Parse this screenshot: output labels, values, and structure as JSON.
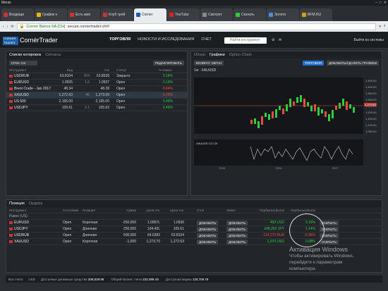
{
  "window": {
    "menu": "Меню"
  },
  "tabs": [
    {
      "label": "Входящи",
      "color": "#cc3333"
    },
    {
      "label": "График н",
      "color": "#e6b800"
    },
    {
      "label": "Есть жив",
      "color": "#cc3333"
    },
    {
      "label": "Клуб трей",
      "color": "#cc3333"
    },
    {
      "label": "Corner",
      "color": "#1f5fa8"
    },
    {
      "label": "YouTube",
      "color": "#e62117"
    },
    {
      "label": "Смотрет",
      "color": "#888888"
    },
    {
      "label": "Скачать",
      "color": "#2ecc40"
    },
    {
      "label": "Золото",
      "color": "#4a90d9"
    },
    {
      "label": "BFM.RU",
      "color": "#d4a017"
    }
  ],
  "address": {
    "site": "Corner Banca SA [CH]",
    "url": "secure.cornertrader.ch/#"
  },
  "header": {
    "logo": "CORNER TRADER",
    "title": "CornèrTrader",
    "nav": [
      "ТОРГОВЛЯ",
      "НОВОСТИ И ИССЛЕДОВАНИЯ",
      "СЧЕТ"
    ],
    "search_placeholder": "Найти инструмент",
    "logout": "Выйти из системы"
  },
  "watchlist": {
    "tabs": [
      "Списки котировок",
      "Сигналы"
    ],
    "filter": "CFDs: US",
    "edit": "РЕДАКТИРОВАТЬ",
    "headers": [
      "Инструмент",
      "Бид",
      "",
      "Аск",
      "Статус",
      "% Измен."
    ],
    "rows": [
      {
        "name": "USDRUB",
        "bid": "63.8104",
        "spread": "424",
        "ask": "63.8528",
        "status": "Закрыто",
        "chg": "0.18%",
        "dir": "up"
      },
      {
        "name": "EURUSD",
        "bid": "1.0935",
        "spread": "1.6",
        "ask": "1.0937",
        "status": "Open",
        "chg": "0.19%",
        "dir": "up"
      },
      {
        "name": "Brent Crude - Jan 2017",
        "bid": "48.34",
        "spread": "",
        "ask": "48.38",
        "status": "Open",
        "chg": "-0.84%",
        "dir": "down"
      },
      {
        "name": "XAUUSD",
        "bid": "1,272.63",
        "spread": "46",
        "ask": "1,273.09",
        "status": "Open",
        "chg": "-0.22%",
        "dir": "down"
      },
      {
        "name": "US 500",
        "bid": "2,165.00",
        "spread": "",
        "ask": "2,165.00",
        "status": "Open",
        "chg": "0.45%",
        "dir": "up"
      },
      {
        "name": "USDJPY",
        "bid": "105.61",
        "spread": "2.1",
        "ask": "105.63",
        "status": "Open",
        "chg": "0.49%",
        "dir": "up"
      }
    ]
  },
  "chart": {
    "tabs": [
      "Обзор",
      "Графики",
      "Option Chain"
    ],
    "back": "ВОЗВРАТ ЭКРАН",
    "trade": "ТОРГОВЛЯ",
    "add": "ДОБАВИТЬ/УДАЛИТЬ ГРАФИКИ",
    "symbol": "XAUUSD",
    "interval": "1w",
    "last": "1,272.63",
    "yticks": [
      "1,450.00",
      "1,400.00",
      "1,350.00",
      "1,300.00",
      "1,250.00",
      "1,200.00",
      "1,150.00",
      "1,100.00",
      "1,050.00"
    ],
    "xticks": [
      "2015",
      "2016",
      "2017"
    ],
    "ind_label": "XAUUSD  CCI 20",
    "ind_yticks": [
      "100.00",
      "0.00",
      "-100.00"
    ]
  },
  "positions": {
    "tabs": [
      "Позиция",
      "Ордера"
    ],
    "headers": [
      "Инструмент",
      "",
      "Состояние",
      "Позиция",
      "Сумма",
      "Цена отк.",
      "Цена тек.",
      "",
      "Стоп",
      "",
      "Лимит",
      "Прибыль/убыток",
      "Прибыль/убыток"
    ],
    "group": "Равно (US)",
    "rows": [
      {
        "name": "EURUSD",
        "status": "Open",
        "side": "Короткая",
        "amount": "-250,000",
        "open": "1.0957L",
        "cur": "1.0936",
        "pnl": "450 USD",
        "pct": "0.19%",
        "dir": "up"
      },
      {
        "name": "USDJPY",
        "status": "Open",
        "side": "Длинная",
        "amount": "250,000",
        "open": "104.42L",
        "cur": "105.61",
        "pnl": "248,250 JPY",
        "pct": "1.14%",
        "dir": "up"
      },
      {
        "name": "USDRUB",
        "status": "Open",
        "side": "Длинная",
        "amount": "500,000",
        "open": "64.0382",
        "cur": "63.8104",
        "pnl": "-114,270 RUB",
        "pct": "-0.36%",
        "dir": "down"
      },
      {
        "name": "XAUUSD",
        "status": "Open",
        "side": "Короткая",
        "amount": "-1,000",
        "open": "1,273.70",
        "cur": "1,272.63",
        "pnl": "1,070 USD",
        "pct": "0.08%",
        "dir": "up"
      }
    ],
    "add": "ДОБАВИТЬ",
    "close": "ЗАКРЫТЬ"
  },
  "statusbar": {
    "account": "Все счета",
    "currency": "USD",
    "items": [
      {
        "label": "Доступные денежные средства",
        "value": "208,528.98"
      },
      {
        "label": "Общий баланс счета",
        "value": "232,089.19"
      },
      {
        "label": "Доступная маржа",
        "value": "120,709.78"
      }
    ]
  },
  "watermark": {
    "line1": "Активация Windows",
    "line2": "Чтобы активировать Windows,",
    "line3": "перейдите к параметрам",
    "line4": "компьютера."
  }
}
